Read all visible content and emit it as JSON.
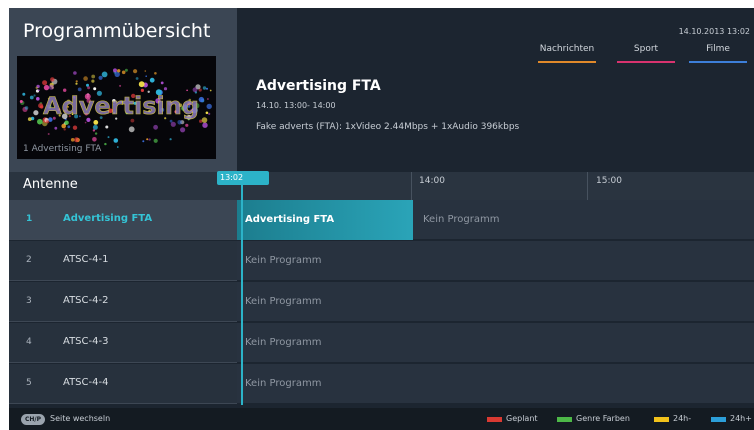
{
  "header": {
    "title": "Programmübersicht",
    "preview_caption": "1 Advertising FTA",
    "preview_art_text": "Advertising",
    "datetime": "14.10.2013 13:02",
    "categories": [
      {
        "label": "Nachrichten",
        "color": "#e0892a"
      },
      {
        "label": "Sport",
        "color": "#d9336f"
      },
      {
        "label": "Filme",
        "color": "#3d7fd9"
      }
    ]
  },
  "program": {
    "title": "Advertising FTA",
    "time": "14.10. 13:00- 14:00",
    "description": "Fake adverts (FTA): 1xVideo 2.44Mbps + 1xAudio 396kbps"
  },
  "timeline": {
    "source": "Antenne",
    "now": "13:02",
    "slots": [
      "14:00",
      "15:00"
    ]
  },
  "channels": [
    {
      "num": "1",
      "name": "Advertising FTA",
      "selected": true
    },
    {
      "num": "2",
      "name": "ATSC-4-1"
    },
    {
      "num": "3",
      "name": "ATSC-4-2"
    },
    {
      "num": "4",
      "name": "ATSC-4-3"
    },
    {
      "num": "5",
      "name": "ATSC-4-4"
    }
  ],
  "events": [
    [
      {
        "title": "Advertising FTA",
        "active": true
      },
      {
        "title": "Kein Programm"
      }
    ],
    [
      {
        "title": "Kein Programm"
      }
    ],
    [
      {
        "title": "Kein Programm"
      }
    ],
    [
      {
        "title": "Kein Programm"
      }
    ],
    [
      {
        "title": "Kein Programm"
      }
    ]
  ],
  "footer": {
    "key": "CH/P",
    "key_label": "Seite wechseln",
    "legend": [
      {
        "label": "Geplant",
        "color": "#d93a32"
      },
      {
        "label": "Genre Farben",
        "color": "#4db848"
      },
      {
        "label": "24h-",
        "color": "#f2c21b"
      },
      {
        "label": "24h+",
        "color": "#2c9fd9"
      }
    ]
  }
}
